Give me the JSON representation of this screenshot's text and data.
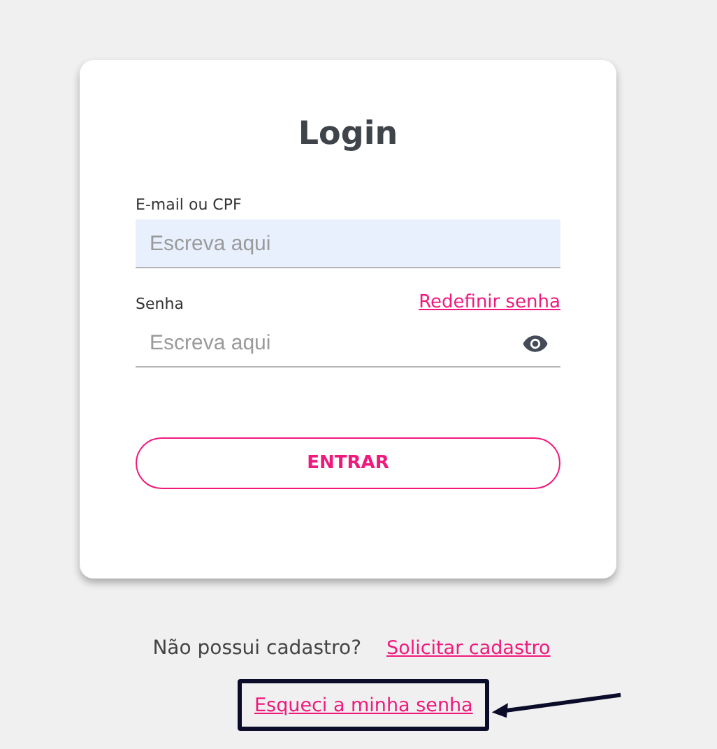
{
  "card": {
    "title": "Login",
    "fields": [
      {
        "label": "E-mail ou CPF",
        "placeholder": "Escreva aqui",
        "kind": "text",
        "autofilled": true
      },
      {
        "label": "Senha",
        "placeholder": "Escreva aqui",
        "kind": "password",
        "autofilled": false,
        "link": "Redefinir senha"
      }
    ],
    "button": "ENTRAR"
  },
  "signup": {
    "question": "Não possui cadastro?",
    "link": "Solicitar cadastro"
  },
  "forgot_link": "Esqueci a minha senha"
}
